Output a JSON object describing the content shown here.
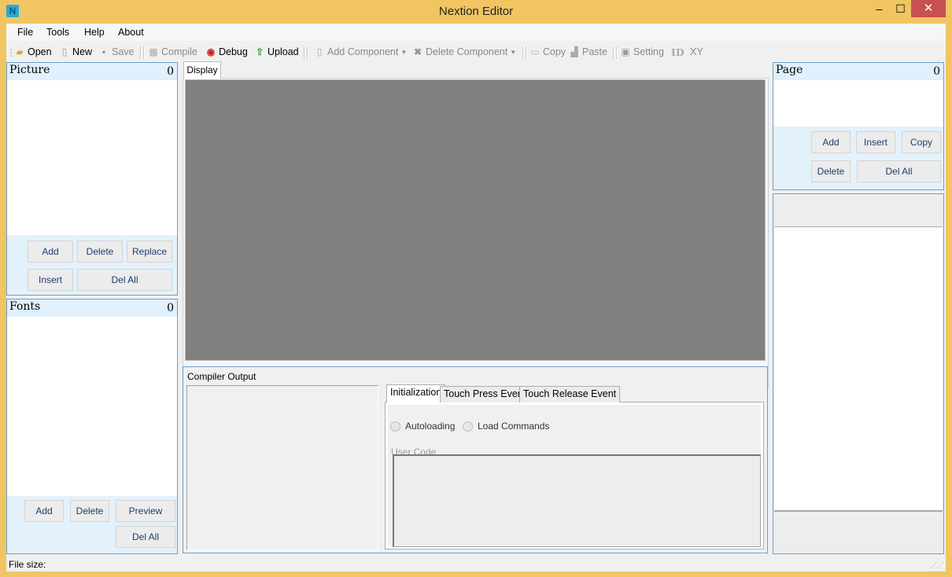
{
  "window": {
    "title": "Nextion Editor",
    "app_icon": "nextion-logo-icon",
    "controls": {
      "minimize": "‒",
      "maximize": "☐",
      "close": "✕"
    }
  },
  "menubar": [
    {
      "label": "File"
    },
    {
      "label": "Tools"
    },
    {
      "label": "Help"
    },
    {
      "label": "About"
    }
  ],
  "toolbar": {
    "open": {
      "label": "Open",
      "icon": "folder-open-icon",
      "enabled": true
    },
    "new": {
      "label": "New",
      "icon": "new-file-icon",
      "enabled": true
    },
    "save": {
      "label": "Save",
      "icon": "save-icon",
      "enabled": false
    },
    "compile": {
      "label": "Compile",
      "icon": "compile-icon",
      "enabled": false
    },
    "debug": {
      "label": "Debug",
      "icon": "debug-icon",
      "enabled": true
    },
    "upload": {
      "label": "Upload",
      "icon": "upload-arrow-icon",
      "enabled": true
    },
    "add_component": {
      "label": "Add Component",
      "icon": "add-component-icon",
      "enabled": false
    },
    "delete_component": {
      "label": "Delete Component",
      "icon": "delete-x-icon",
      "enabled": false
    },
    "copy": {
      "label": "Copy",
      "icon": "copy-icon",
      "enabled": false
    },
    "paste": {
      "label": "Paste",
      "icon": "paste-icon",
      "enabled": false
    },
    "setting": {
      "label": "Setting",
      "icon": "setting-icon",
      "enabled": false
    },
    "id": {
      "label": "ID"
    },
    "xy": {
      "label": "XY"
    }
  },
  "picture_panel": {
    "title": "Picture",
    "count": "0",
    "buttons": {
      "add": "Add",
      "delete": "Delete",
      "replace": "Replace",
      "insert": "Insert",
      "del_all": "Del All"
    }
  },
  "fonts_panel": {
    "title": "Fonts",
    "count": "0",
    "buttons": {
      "add": "Add",
      "delete": "Delete",
      "preview": "Preview",
      "del_all": "Del All"
    }
  },
  "display": {
    "tab_label": "Display"
  },
  "compiler": {
    "title": "Compiler Output",
    "output": ""
  },
  "events": {
    "tabs": [
      {
        "label": "Initialization",
        "active": true
      },
      {
        "label": "Touch Press Event",
        "active": false
      },
      {
        "label": "Touch Release Event",
        "active": false
      }
    ],
    "radios": {
      "autoloading": "Autoloading",
      "load_commands": "Load Commands"
    },
    "user_code_label": "User Code",
    "user_code": ""
  },
  "page_panel": {
    "title": "Page",
    "count": "0",
    "buttons": {
      "add": "Add",
      "insert": "Insert",
      "copy": "Copy",
      "delete": "Delete",
      "del_all": "Del All"
    }
  },
  "statusbar": {
    "file_size_label": "File size:"
  }
}
